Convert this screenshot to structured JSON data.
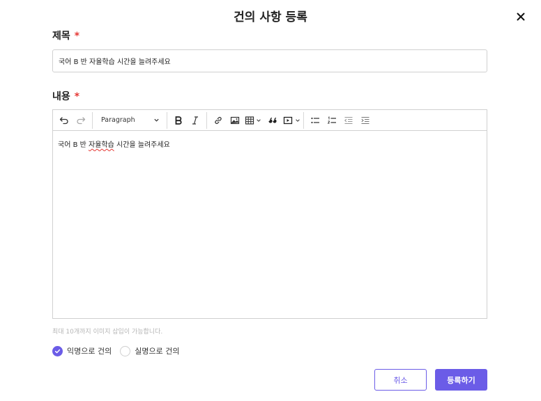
{
  "modal": {
    "title": "건의 사항 등록"
  },
  "title_field": {
    "label": "제목",
    "required_mark": "*",
    "value": "국어 B 반 자율학습 시간을 늘려주세요"
  },
  "content_field": {
    "label": "내용",
    "required_mark": "*",
    "toolbar": {
      "paragraph_label": "Paragraph",
      "icons": [
        "undo-icon",
        "redo-icon",
        "bold-icon",
        "italic-icon",
        "link-icon",
        "image-icon",
        "table-icon",
        "quote-icon",
        "media-icon",
        "bulleted-list-icon",
        "numbered-list-icon",
        "outdent-icon",
        "indent-icon"
      ]
    },
    "body_prefix": "국어 B 반 ",
    "body_misspelled": "자율학습",
    "body_suffix": " 시간을 늘려주세요",
    "helper": "최대 10개까지 이미지 삽입이 가능합니다."
  },
  "options": [
    {
      "label": "익명으로 건의",
      "checked": true
    },
    {
      "label": "실명으로 건의",
      "checked": false
    }
  ],
  "buttons": {
    "cancel": "취소",
    "submit": "등록하기"
  },
  "colors": {
    "accent": "#6b5ce7",
    "required": "#e53935",
    "helper_text": "#b5b5b5",
    "border": "#d0d0d0"
  }
}
